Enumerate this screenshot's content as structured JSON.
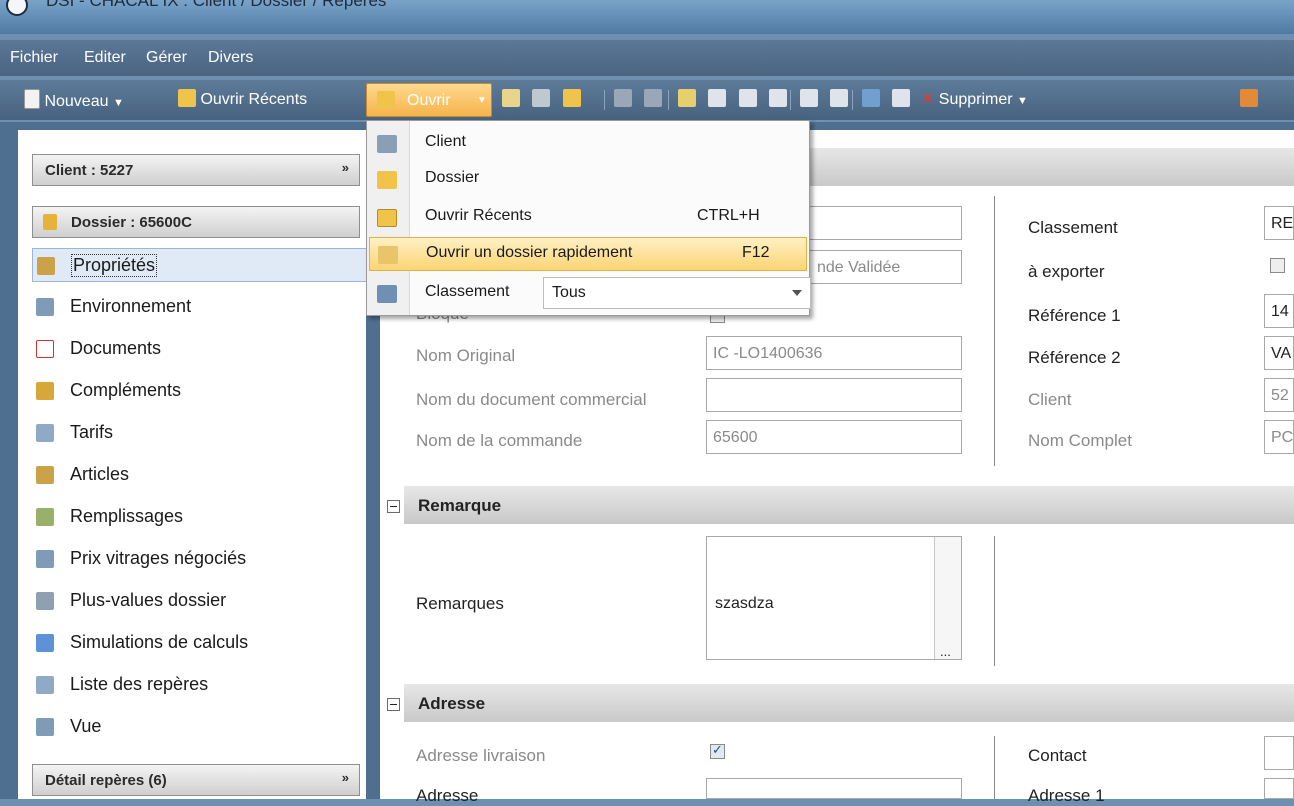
{
  "window": {
    "title": "DSI - CHACAL IX : Client / Dossier / Repères"
  },
  "menubar": [
    "Fichier",
    "Editer",
    "Gérer",
    "Divers"
  ],
  "toolbar": {
    "nouveau": "Nouveau",
    "ouvrir_recents": "Ouvrir Récents",
    "ouvrir": "Ouvrir",
    "supprimer": "Supprimer"
  },
  "open_menu": {
    "items": [
      {
        "label": "Client",
        "shortcut": ""
      },
      {
        "label": "Dossier",
        "shortcut": ""
      },
      {
        "label": "Ouvrir Récents",
        "shortcut": "CTRL+H"
      },
      {
        "label": "Ouvrir un dossier rapidement",
        "shortcut": "F12"
      }
    ],
    "classement_label": "Classement",
    "classement_value": "Tous"
  },
  "sidebar": {
    "client_header": "Client : 5227",
    "dossier_header": "Dossier : 65600C",
    "items": [
      {
        "label": "Propriétés"
      },
      {
        "label": "Environnement"
      },
      {
        "label": "Documents"
      },
      {
        "label": "Compléments"
      },
      {
        "label": "Tarifs"
      },
      {
        "label": "Articles"
      },
      {
        "label": "Remplissages"
      },
      {
        "label": "Prix vitrages négociés"
      },
      {
        "label": "Plus-values dossier"
      },
      {
        "label": "Simulations de calculs"
      },
      {
        "label": "Liste des repères"
      },
      {
        "label": "Vue"
      }
    ],
    "detail_header": "Détail repères (6)"
  },
  "form": {
    "bloque_label": "Bloqué",
    "validee_text": "nde Validée",
    "nom_original_label": "Nom Original",
    "nom_original_value": "IC -LO1400636",
    "nom_doc_label": "Nom du document commercial",
    "nom_doc_value": "",
    "nom_commande_label": "Nom de la commande",
    "nom_commande_value": "65600",
    "classement_label": "Classement",
    "classement_value": "RE",
    "exporter_label": "à exporter",
    "ref1_label": "Référence 1",
    "ref1_value": "14",
    "ref2_label": "Référence 2",
    "ref2_value": "VA",
    "client_label": "Client",
    "client_value": "52",
    "nom_complet_label": "Nom Complet",
    "nom_complet_value": "PC"
  },
  "remarque": {
    "title": "Remarque",
    "label": "Remarques",
    "value": "szasdza",
    "more": "..."
  },
  "adresse": {
    "title": "Adresse",
    "livraison_label": "Adresse livraison",
    "adresse_label": "Adresse",
    "contact_label": "Contact",
    "adresse1_label": "Adresse 1"
  }
}
